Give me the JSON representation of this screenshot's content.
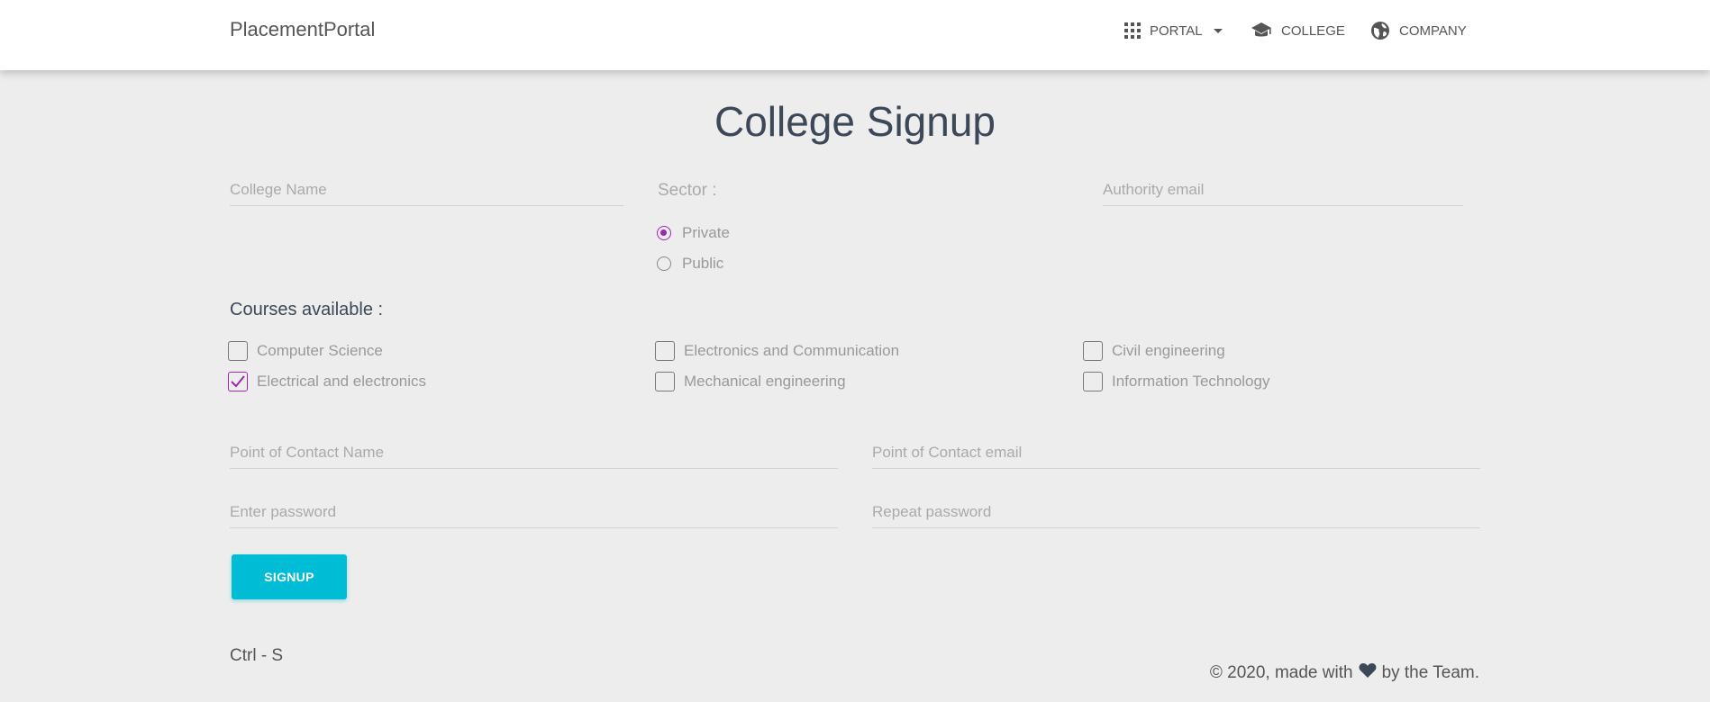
{
  "navbar": {
    "brand": "PlacementPortal",
    "items": [
      {
        "label": "PORTAL",
        "icon": "apps-grid-icon",
        "has_dropdown": true
      },
      {
        "label": "COLLEGE",
        "icon": "graduation-cap-icon"
      },
      {
        "label": "COMPANY",
        "icon": "globe-icon"
      }
    ]
  },
  "page": {
    "title": "College Signup"
  },
  "form": {
    "college_name": {
      "placeholder": "College Name",
      "value": ""
    },
    "authority_email": {
      "placeholder": "Authority email",
      "value": ""
    },
    "sector": {
      "label": "Sector :",
      "options": [
        {
          "label": "Private",
          "checked": true
        },
        {
          "label": "Public",
          "checked": false
        }
      ]
    },
    "courses": {
      "label": "Courses available :",
      "options": [
        {
          "label": "Computer Science",
          "checked": false
        },
        {
          "label": "Electronics and Communication",
          "checked": false
        },
        {
          "label": "Civil engineering",
          "checked": false
        },
        {
          "label": "Electrical and electronics",
          "checked": true
        },
        {
          "label": "Mechanical engineering",
          "checked": false
        },
        {
          "label": "Information Technology",
          "checked": false
        }
      ]
    },
    "poc_name": {
      "placeholder": "Point of Contact Name",
      "value": ""
    },
    "poc_email": {
      "placeholder": "Point of Contact email",
      "value": ""
    },
    "password": {
      "placeholder": "Enter password",
      "value": ""
    },
    "repeat_password": {
      "placeholder": "Repeat password",
      "value": ""
    },
    "submit_label": "SIGNUP"
  },
  "hint": "Ctrl - S",
  "footer": {
    "before": "© 2020, made with",
    "icon": "heart-icon",
    "after": "by the Team."
  },
  "colors": {
    "accent": "#9c27b0",
    "button": "#00bcd4",
    "background": "#ededed"
  }
}
